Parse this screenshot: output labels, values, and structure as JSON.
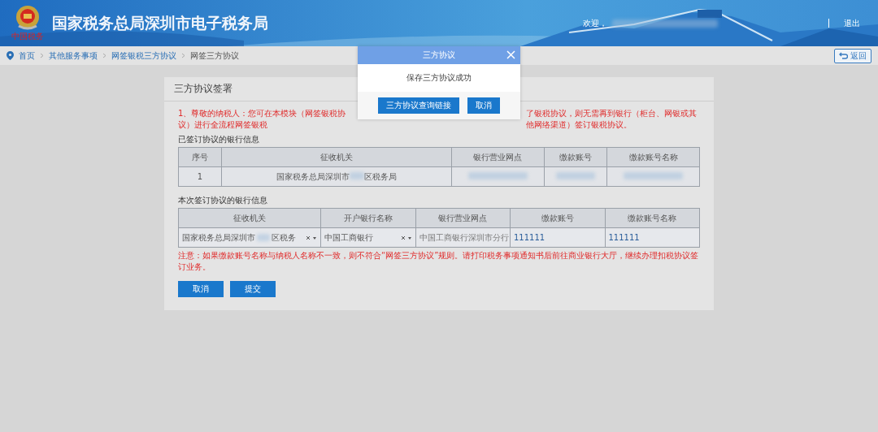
{
  "header": {
    "logo_caption": "中国税务",
    "title": "国家税务总局深圳市电子税务局",
    "welcome": "欢迎，",
    "logout": "退出"
  },
  "breadcrumb": [
    {
      "label": "首页",
      "link": true
    },
    {
      "label": "其他服务事项",
      "link": true
    },
    {
      "label": "网签银税三方协议",
      "link": true
    },
    {
      "label": "网签三方协议",
      "link": false
    }
  ],
  "back_button": "返回",
  "card": {
    "title": "三方协议签署",
    "notice_start": "1、尊敬的纳税人：您可在本模块（网签银税协议）进行全流程网签银税",
    "notice_end": "了银税协议，则无需再到银行（柜台、网银或其他网络渠道）签订银税协议。",
    "signed_section": "已签订协议的银行信息",
    "signed_table": {
      "columns": [
        "序号",
        "征收机关",
        "银行营业网点",
        "缴款账号",
        "缴款账号名称"
      ],
      "rows": [
        [
          {
            "kind": "text",
            "text": "1"
          },
          {
            "kind": "split",
            "before": "国家税务总局深圳市",
            "after": "区税务局"
          },
          {
            "kind": "redacted"
          },
          {
            "kind": "redacted"
          },
          {
            "kind": "redacted"
          }
        ]
      ]
    },
    "new_section": "本次签订协议的银行信息",
    "new_table": {
      "columns": [
        "征收机关",
        "开户银行名称",
        "银行营业网点",
        "缴款账号",
        "缴款账号名称"
      ],
      "row": [
        {
          "kind": "select",
          "value": "国家税务总局深圳市",
          "value_after": "区税务"
        },
        {
          "kind": "select",
          "value": "中国工商银行"
        },
        {
          "kind": "readonly",
          "value": "中国工商银行深圳市分行"
        },
        {
          "kind": "input",
          "value": "111111"
        },
        {
          "kind": "input",
          "value": "111111"
        }
      ]
    },
    "warning": "注意：如果缴款账号名称与纳税人名称不一致，则不符合“网签三方协议”规则。请打印税务事项通知书后前往商业银行大厅，继续办理扣税协议签订业务。",
    "buttons": [
      "取消",
      "提交"
    ]
  },
  "dialog": {
    "title": "三方协议",
    "message": "保存三方协议成功",
    "buttons": [
      "三方协议查询链接",
      "取消"
    ]
  }
}
